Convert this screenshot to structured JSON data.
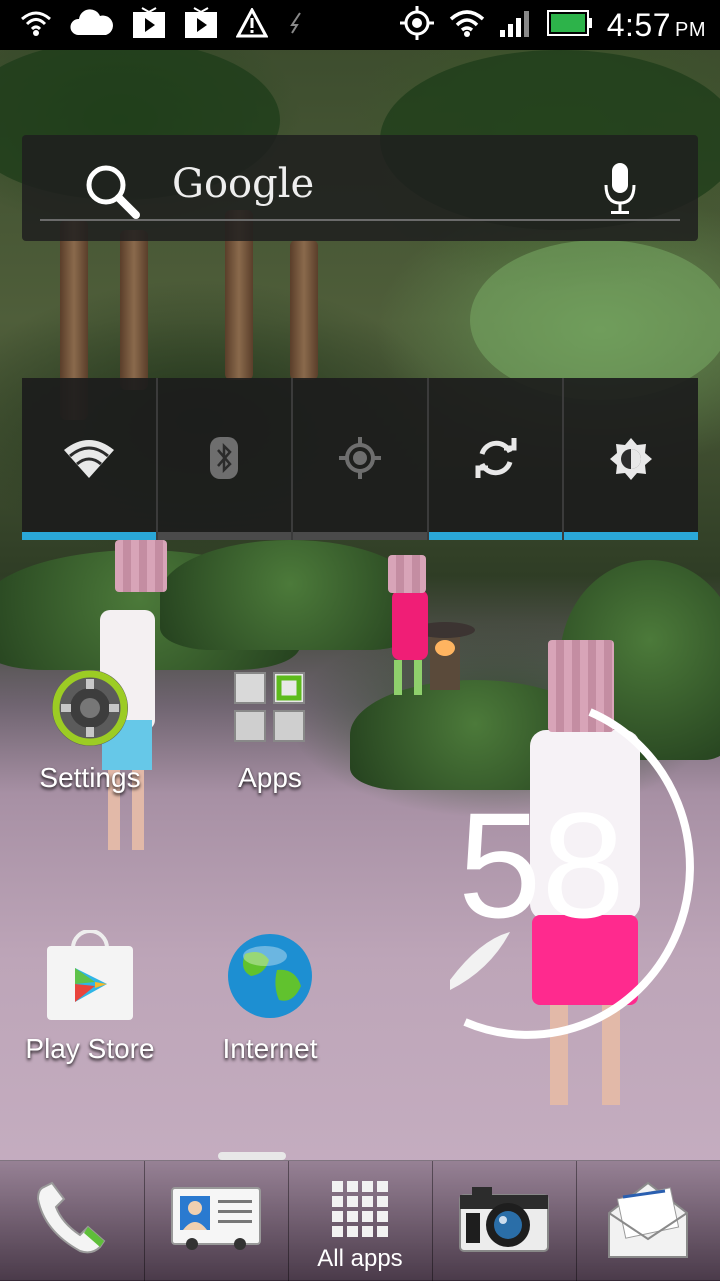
{
  "status_bar": {
    "time": "4:57",
    "ampm": "PM",
    "left_icons": [
      "wifi-icon",
      "cloud-icon",
      "play-notification-icon",
      "play-notification-icon",
      "warning-icon",
      "usb-icon"
    ],
    "right_icons": [
      "gps-icon",
      "wifi-icon",
      "signal-icon",
      "battery-icon"
    ]
  },
  "search_widget": {
    "brand": "Google"
  },
  "power_widget": {
    "toggles": [
      {
        "icon": "wifi-icon",
        "on": true
      },
      {
        "icon": "bluetooth-icon",
        "on": false
      },
      {
        "icon": "gps-icon",
        "on": false
      },
      {
        "icon": "sync-icon",
        "on": true
      },
      {
        "icon": "brightness-icon",
        "on": true
      }
    ],
    "accent": "#2aa7d8"
  },
  "apps": [
    {
      "label": "Settings",
      "icon": "settings-icon"
    },
    {
      "label": "Apps",
      "icon": "apps-grid-icon"
    },
    {
      "label": "Play Store",
      "icon": "play-store-icon"
    },
    {
      "label": "Internet",
      "icon": "globe-icon"
    }
  ],
  "clock_widget": {
    "value": "58"
  },
  "dock": {
    "items": [
      {
        "name": "phone",
        "icon": "phone-icon"
      },
      {
        "name": "contacts",
        "icon": "contacts-icon"
      },
      {
        "name": "all-apps",
        "icon": "all-apps-icon",
        "label": "All apps"
      },
      {
        "name": "camera",
        "icon": "camera-icon"
      },
      {
        "name": "mail",
        "icon": "mail-icon"
      }
    ]
  }
}
